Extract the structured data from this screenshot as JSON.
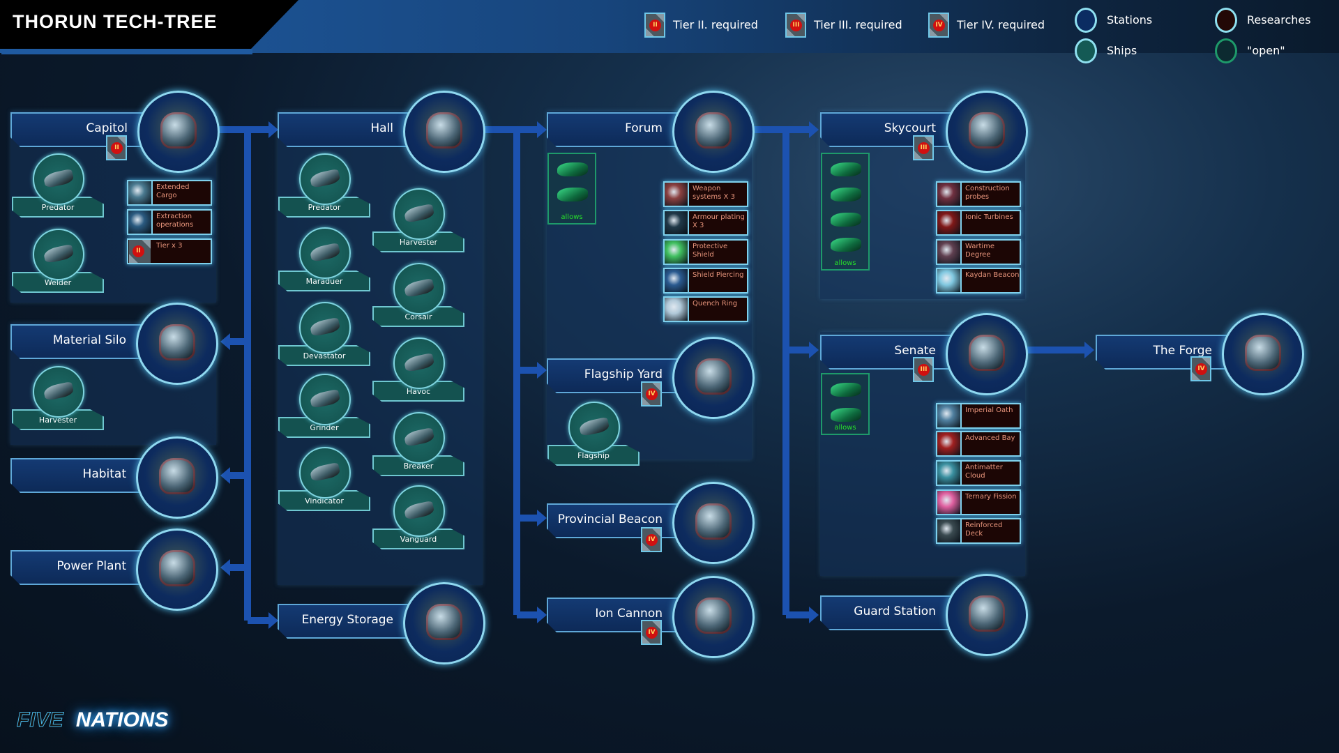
{
  "header": {
    "title": "THORUN TECH-TREE"
  },
  "legend": {
    "tiers": [
      {
        "numeral": "II",
        "label": "Tier II. required"
      },
      {
        "numeral": "III",
        "label": "Tier III. required"
      },
      {
        "numeral": "IV",
        "label": "Tier IV. required"
      }
    ],
    "types": [
      {
        "label": "Stations",
        "color": "#0b2c62"
      },
      {
        "label": "Ships",
        "color": "#145a55"
      },
      {
        "label": "Researches",
        "color": "#220806"
      },
      {
        "label": "\"open\"",
        "color": "#0c2a30"
      }
    ]
  },
  "stations": [
    {
      "name": "Capitol",
      "tier": "II"
    },
    {
      "name": "Material Silo"
    },
    {
      "name": "Habitat"
    },
    {
      "name": "Power Plant"
    },
    {
      "name": "Hall"
    },
    {
      "name": "Energy Storage"
    },
    {
      "name": "Forum"
    },
    {
      "name": "Flagship Yard",
      "tier": "IV"
    },
    {
      "name": "Provincial Beacon",
      "tier": "IV"
    },
    {
      "name": "Ion Cannon",
      "tier": "IV"
    },
    {
      "name": "Skycourt",
      "tier": "III"
    },
    {
      "name": "Senate",
      "tier": "III"
    },
    {
      "name": "Guard Station"
    },
    {
      "name": "The Forge",
      "tier": "IV"
    }
  ],
  "ships": [
    {
      "name": "Predator"
    },
    {
      "name": "Welder"
    },
    {
      "name": "Harvester"
    },
    {
      "name": "Predator"
    },
    {
      "name": "Maraduer"
    },
    {
      "name": "Devastator"
    },
    {
      "name": "Grinder"
    },
    {
      "name": "Vindicator"
    },
    {
      "name": "Harvester"
    },
    {
      "name": "Corsair"
    },
    {
      "name": "Havoc"
    },
    {
      "name": "Breaker"
    },
    {
      "name": "Vanguard"
    },
    {
      "name": "Flagship"
    }
  ],
  "researches": [
    {
      "name": "Extended Cargo"
    },
    {
      "name": "Extraction operations"
    },
    {
      "name": "Tier x 3",
      "tier": "II"
    },
    {
      "name": "Weapon systems X 3"
    },
    {
      "name": "Armour plating X 3"
    },
    {
      "name": "Protective Shield"
    },
    {
      "name": "Shield Piercing"
    },
    {
      "name": "Quench Ring"
    },
    {
      "name": "Construction probes"
    },
    {
      "name": "Ionic Turbines"
    },
    {
      "name": "Wartime Degree"
    },
    {
      "name": "Kaydan Beacon"
    },
    {
      "name": "Imperial Oath"
    },
    {
      "name": "Advanced Bay"
    },
    {
      "name": "Antimatter Cloud"
    },
    {
      "name": "Ternary Fission"
    },
    {
      "name": "Reinforced Deck"
    }
  ],
  "allows_label": "allows",
  "logo": {
    "part1": "FIVE",
    "part2": "NATIONS"
  }
}
